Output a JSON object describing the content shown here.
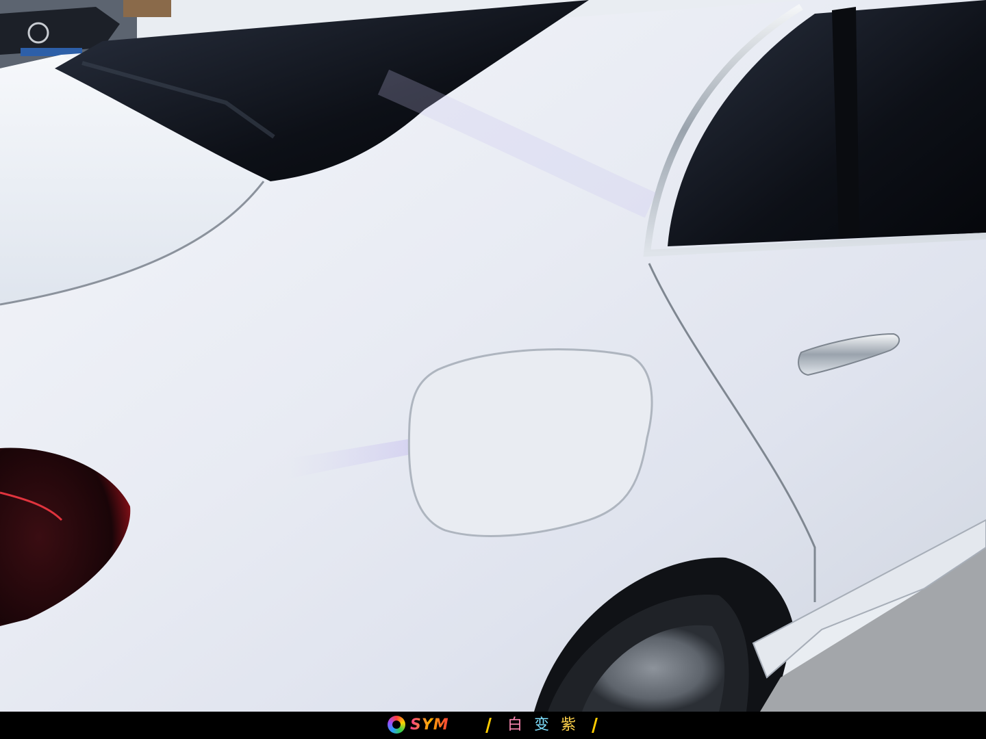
{
  "banner": {
    "brand": "SYM",
    "tagline_chars": [
      "白",
      "变",
      "紫"
    ],
    "colors": {
      "bar": "#ffcc00",
      "char1": "#ff8ab5",
      "char2": "#7ee0ff",
      "char3": "#ffd24a"
    }
  },
  "photo": {
    "subject": "white-sedan-rear-quarter",
    "icons": [
      "fuel-door",
      "door-handle",
      "tail-light",
      "wheel",
      "window"
    ]
  }
}
